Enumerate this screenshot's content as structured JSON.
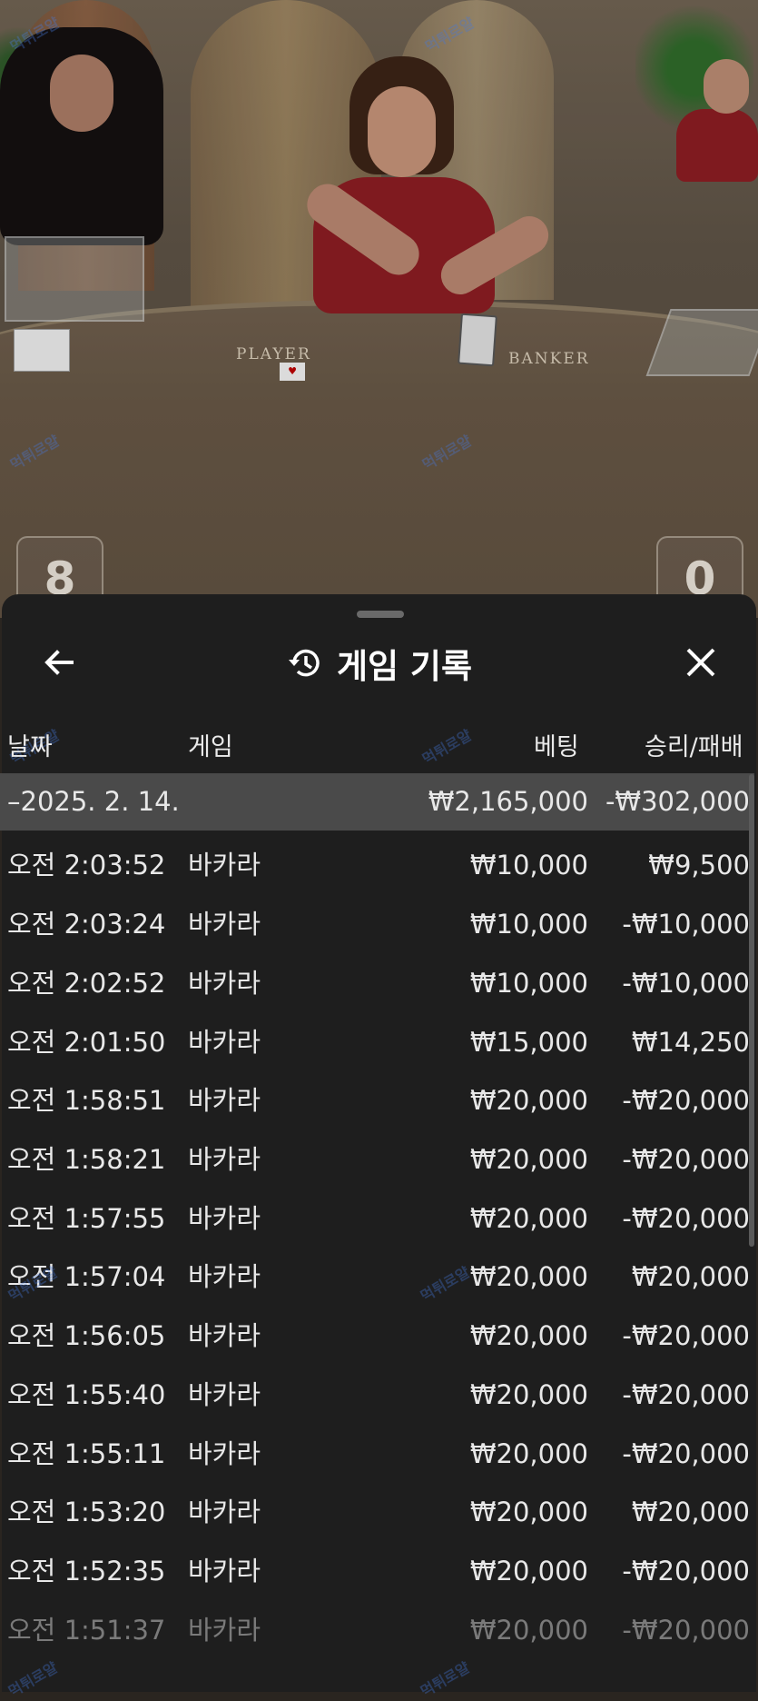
{
  "video": {
    "player_label": "PLAYER",
    "banker_label": "BANKER",
    "player_score": "8",
    "banker_score": "0"
  },
  "sheet": {
    "title": "게임 기록",
    "back_icon": "arrow-left-icon",
    "close_icon": "close-icon",
    "history_icon": "history-icon"
  },
  "columns": {
    "date": "날짜",
    "game": "게임",
    "bet": "베팅",
    "result": "승리/패배"
  },
  "summary": {
    "date": "–2025. 2. 14.",
    "bet": "₩2,165,000",
    "result": "-₩302,000"
  },
  "rows": [
    {
      "time": "오전 2:03:52",
      "game": "바카라",
      "bet": "₩10,000",
      "result": "₩9,500"
    },
    {
      "time": "오전 2:03:24",
      "game": "바카라",
      "bet": "₩10,000",
      "result": "-₩10,000"
    },
    {
      "time": "오전 2:02:52",
      "game": "바카라",
      "bet": "₩10,000",
      "result": "-₩10,000"
    },
    {
      "time": "오전 2:01:50",
      "game": "바카라",
      "bet": "₩15,000",
      "result": "₩14,250"
    },
    {
      "time": "오전 1:58:51",
      "game": "바카라",
      "bet": "₩20,000",
      "result": "-₩20,000"
    },
    {
      "time": "오전 1:58:21",
      "game": "바카라",
      "bet": "₩20,000",
      "result": "-₩20,000"
    },
    {
      "time": "오전 1:57:55",
      "game": "바카라",
      "bet": "₩20,000",
      "result": "-₩20,000"
    },
    {
      "time": "오전 1:57:04",
      "game": "바카라",
      "bet": "₩20,000",
      "result": "₩20,000"
    },
    {
      "time": "오전 1:56:05",
      "game": "바카라",
      "bet": "₩20,000",
      "result": "-₩20,000"
    },
    {
      "time": "오전 1:55:40",
      "game": "바카라",
      "bet": "₩20,000",
      "result": "-₩20,000"
    },
    {
      "time": "오전 1:55:11",
      "game": "바카라",
      "bet": "₩20,000",
      "result": "-₩20,000"
    },
    {
      "time": "오전 1:53:20",
      "game": "바카라",
      "bet": "₩20,000",
      "result": "₩20,000"
    },
    {
      "time": "오전 1:52:35",
      "game": "바카라",
      "bet": "₩20,000",
      "result": "-₩20,000"
    },
    {
      "time": "오전 1:51:37",
      "game": "바카라",
      "bet": "₩20,000",
      "result": "-₩20,000"
    }
  ],
  "watermark_text": "먹튀로얄"
}
